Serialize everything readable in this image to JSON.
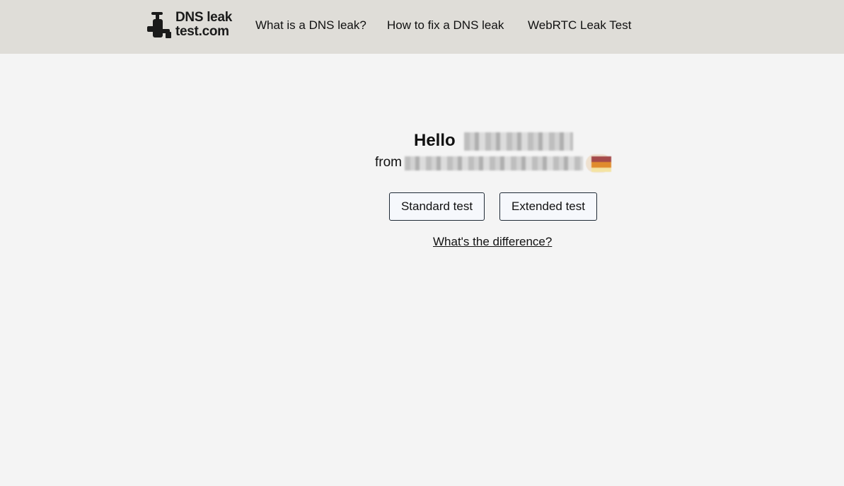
{
  "header": {
    "logo": {
      "line1": "DNS leak",
      "line2": "test.com",
      "icon": "tap-icon"
    },
    "nav": [
      {
        "label": "What is a DNS leak?"
      },
      {
        "label": "How to fix a DNS leak"
      },
      {
        "label": "WebRTC Leak Test"
      }
    ]
  },
  "main": {
    "greeting": "Hello",
    "from_label": "from",
    "buttons": {
      "standard": "Standard test",
      "extended": "Extended test"
    },
    "difference_link": "What's the difference?"
  },
  "colors": {
    "header_bg": "#dfddd8",
    "page_bg": "#f4f4f4",
    "text": "#111111"
  }
}
